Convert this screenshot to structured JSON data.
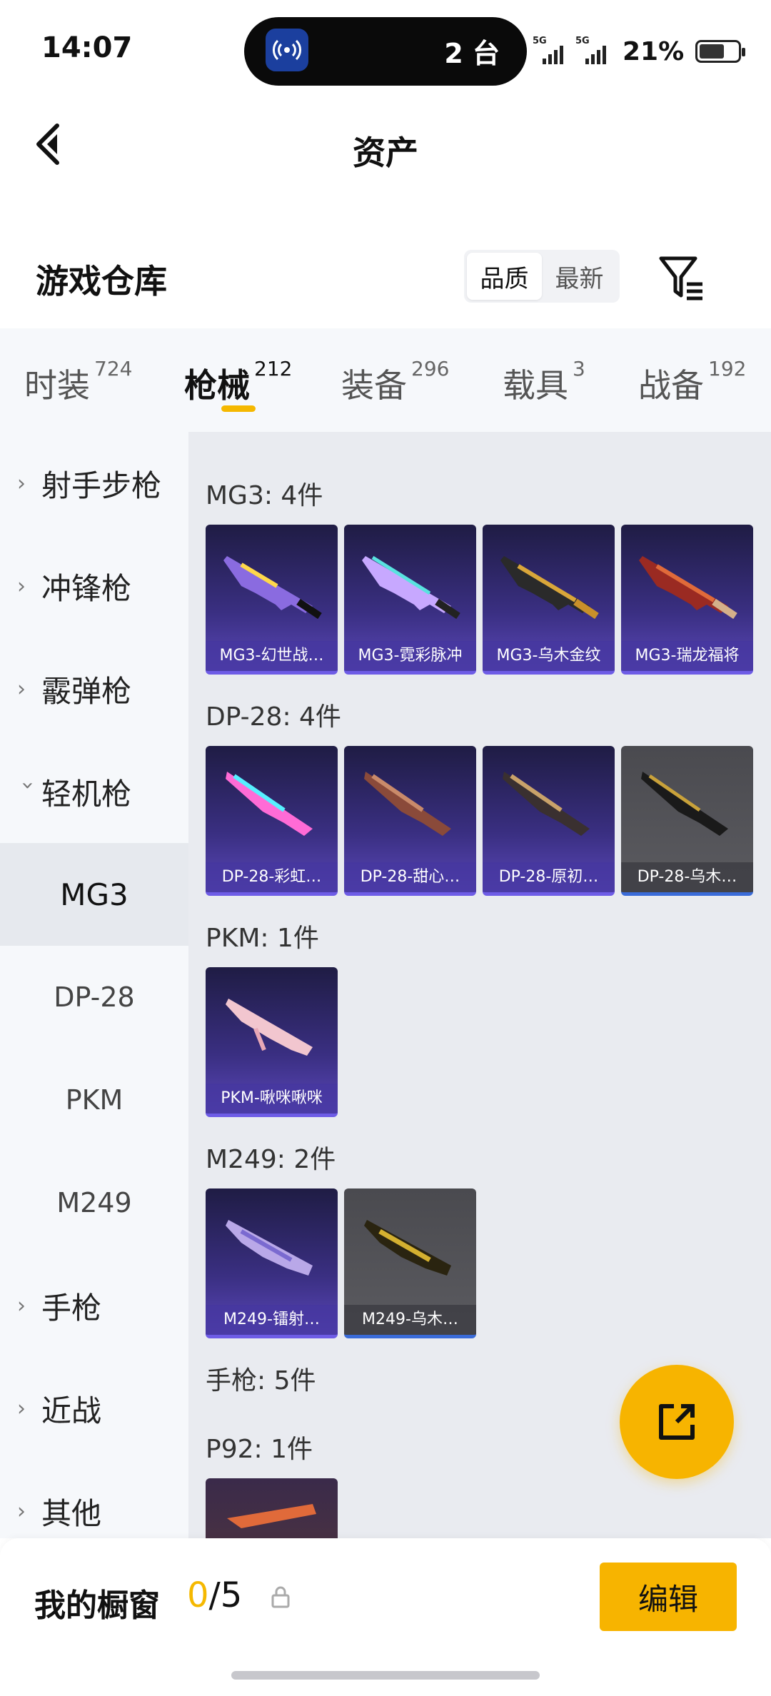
{
  "status_bar": {
    "time": "14:07",
    "island_text": "2 台",
    "island_icon_badge": "2",
    "network_label_1": "5G",
    "network_label_2": "5G",
    "battery": "21%"
  },
  "header": {
    "title": "资产"
  },
  "warehouse": {
    "title": "游戏仓库",
    "sort_options": [
      "品质",
      "最新"
    ],
    "selected_sort": "品质"
  },
  "tabs": [
    {
      "label": "时装",
      "count": "724"
    },
    {
      "label": "枪械",
      "count": "212"
    },
    {
      "label": "装备",
      "count": "296"
    },
    {
      "label": "载具",
      "count": "3"
    },
    {
      "label": "战备",
      "count": "192"
    }
  ],
  "sidebar": {
    "categories": [
      {
        "label": "射手步枪"
      },
      {
        "label": "冲锋枪"
      },
      {
        "label": "霰弹枪"
      },
      {
        "label": "轻机枪"
      },
      {
        "label": "手枪"
      },
      {
        "label": "近战"
      },
      {
        "label": "其他"
      }
    ],
    "subitems": [
      "MG3",
      "DP-28",
      "PKM",
      "M249"
    ],
    "active_sub": "MG3"
  },
  "content": {
    "groups": [
      {
        "title": "MG3: 4件",
        "items": [
          {
            "name": "MG3-幻世战…",
            "rarity": "purple"
          },
          {
            "name": "MG3-霓彩脉冲",
            "rarity": "purple"
          },
          {
            "name": "MG3-乌木金纹",
            "rarity": "purple"
          },
          {
            "name": "MG3-瑞龙福将",
            "rarity": "purple"
          }
        ]
      },
      {
        "title": "DP-28: 4件",
        "items": [
          {
            "name": "DP-28-彩虹…",
            "rarity": "purple"
          },
          {
            "name": "DP-28-甜心…",
            "rarity": "purple"
          },
          {
            "name": "DP-28-原初…",
            "rarity": "purple"
          },
          {
            "name": "DP-28-乌木…",
            "rarity": "gray"
          }
        ]
      },
      {
        "title": "PKM: 1件",
        "items": [
          {
            "name": "PKM-啾咪啾咪",
            "rarity": "purple"
          }
        ]
      },
      {
        "title": "M249: 2件",
        "items": [
          {
            "name": "M249-镭射…",
            "rarity": "purple"
          },
          {
            "name": "M249-乌木…",
            "rarity": "gray"
          }
        ]
      }
    ],
    "pistol_title": "手枪: 5件",
    "p92_title": "P92: 1件"
  },
  "bottom_bar": {
    "label": "我的橱窗",
    "count_current": "0",
    "count_total": "/5",
    "edit_label": "编辑"
  },
  "colors": {
    "accent": "#f7b400",
    "purple_card": "#3a2f82",
    "sidebar_bg": "#f6f8fb",
    "content_bg": "#e9ebf0"
  }
}
